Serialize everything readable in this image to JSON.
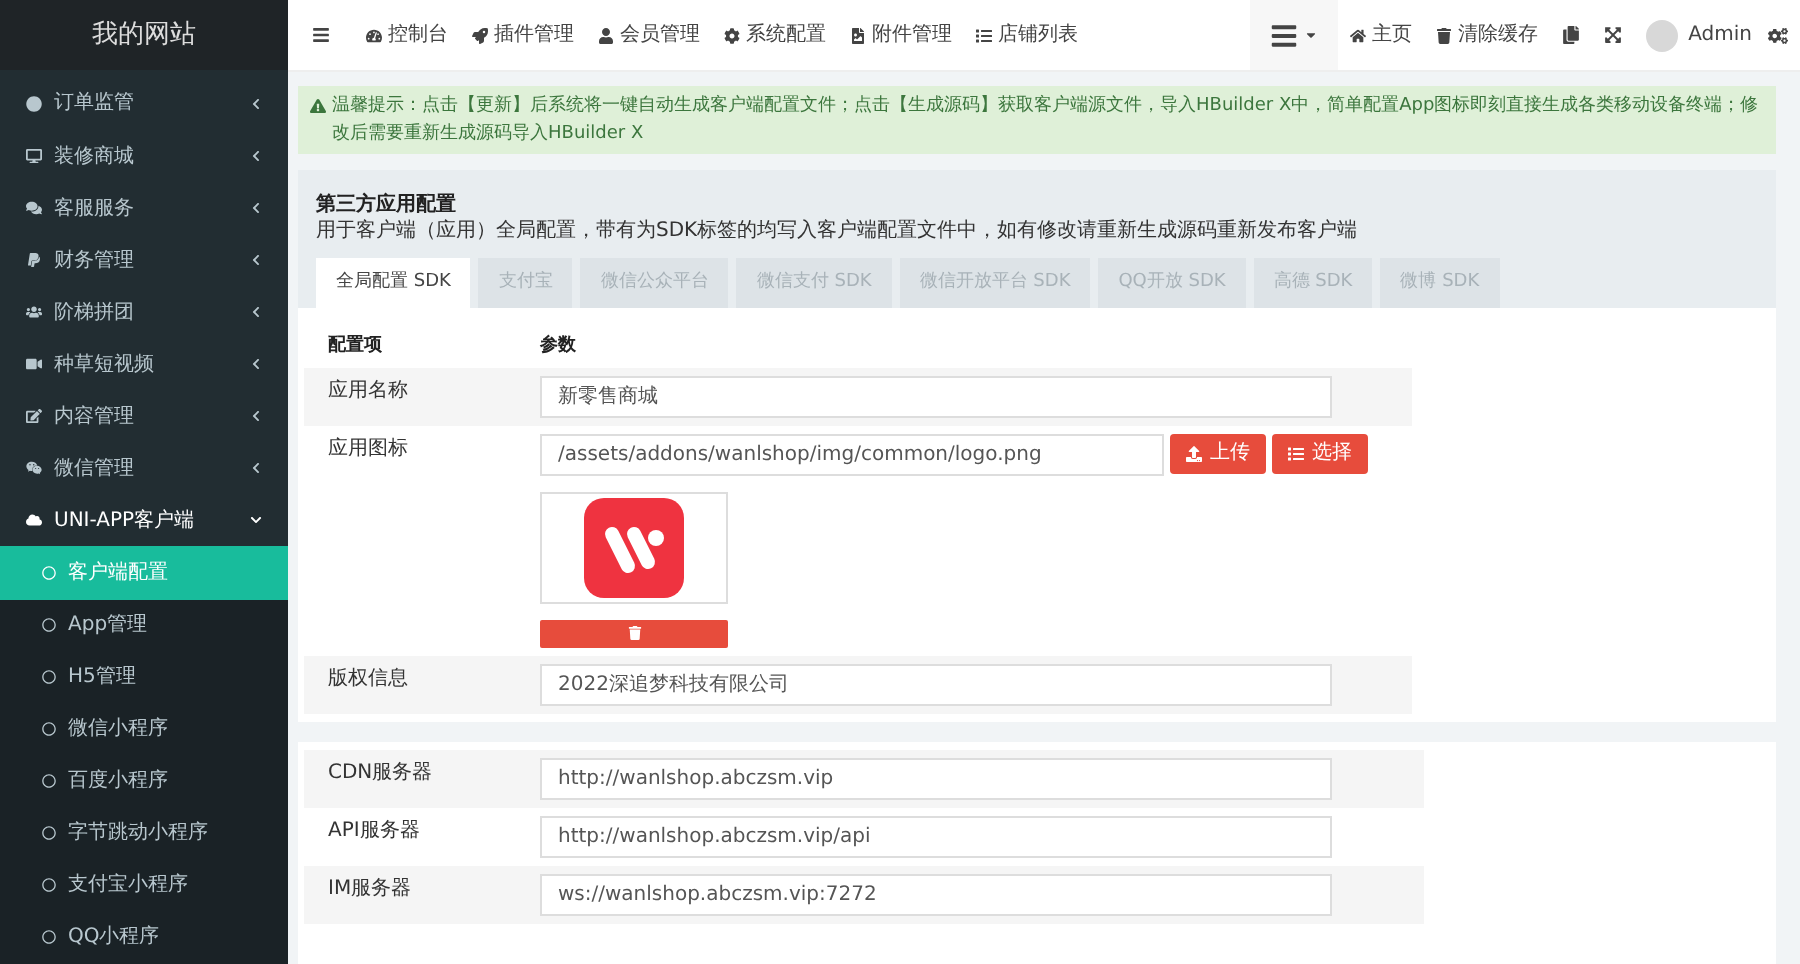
{
  "sidebar": {
    "title": "我的网站",
    "items": [
      {
        "label": "订单监管",
        "expanded": false
      },
      {
        "label": "装修商城",
        "expanded": false
      },
      {
        "label": "客服服务",
        "expanded": false
      },
      {
        "label": "财务管理",
        "expanded": false
      },
      {
        "label": "阶梯拼团",
        "expanded": false
      },
      {
        "label": "种草短视频",
        "expanded": false
      },
      {
        "label": "内容管理",
        "expanded": false
      },
      {
        "label": "微信管理",
        "expanded": false
      },
      {
        "label": "UNI-APP客户端",
        "expanded": true,
        "children": [
          {
            "label": "客户端配置",
            "selected": true
          },
          {
            "label": "App管理",
            "selected": false
          },
          {
            "label": "H5管理",
            "selected": false
          },
          {
            "label": "微信小程序",
            "selected": false
          },
          {
            "label": "百度小程序",
            "selected": false
          },
          {
            "label": "字节跳动小程序",
            "selected": false
          },
          {
            "label": "支付宝小程序",
            "selected": false
          },
          {
            "label": "QQ小程序",
            "selected": false
          }
        ]
      }
    ]
  },
  "topbar": {
    "nav": [
      "控制台",
      "插件管理",
      "会员管理",
      "系统配置",
      "附件管理",
      "店铺列表"
    ],
    "right": [
      "主页",
      "清除缓存"
    ],
    "user": "Admin"
  },
  "alert": "温馨提示：点击【更新】后系统将一键自动生成客户端配置文件；点击【生成源码】获取客户端源文件，导入HBuilder X中，简单配置App图标即刻直接生成各类移动设备终端；修改后需要重新生成源码导入HBuilder X",
  "panel": {
    "title": "第三方应用配置",
    "description": "用于客户端（应用）全局配置，带有为SDK标签的均写入客户端配置文件中，如有修改请重新生成源码重新发布客户端",
    "tabs": [
      {
        "label": "全局配置 SDK",
        "selected": true
      },
      {
        "label": "支付宝",
        "selected": false
      },
      {
        "label": "微信公众平台",
        "selected": false
      },
      {
        "label": "微信支付 SDK",
        "selected": false
      },
      {
        "label": "微信开放平台 SDK",
        "selected": false
      },
      {
        "label": "QQ开放 SDK",
        "selected": false
      },
      {
        "label": "高德 SDK",
        "selected": false
      },
      {
        "label": "微博 SDK",
        "selected": false
      }
    ],
    "columns": [
      "配置项",
      "参数"
    ],
    "fields": [
      {
        "kind": "text",
        "label": "应用名称",
        "value": "新零售商城"
      },
      {
        "kind": "image",
        "label": "应用图标",
        "value": "/assets/addons/wanlshop/img/common/logo.png",
        "buttons": [
          "上传",
          "选择"
        ]
      },
      {
        "kind": "text",
        "label": "版权信息",
        "value": "2022深追梦科技有限公司"
      }
    ],
    "server_fields": [
      {
        "kind": "text",
        "label": "CDN服务器",
        "value": "http://wanlshop.abczsm.vip"
      },
      {
        "kind": "text",
        "label": "API服务器",
        "value": "http://wanlshop.abczsm.vip/api"
      },
      {
        "kind": "text",
        "label": "IM服务器",
        "value": "ws://wanlshop.abczsm.vip:7272"
      }
    ]
  }
}
